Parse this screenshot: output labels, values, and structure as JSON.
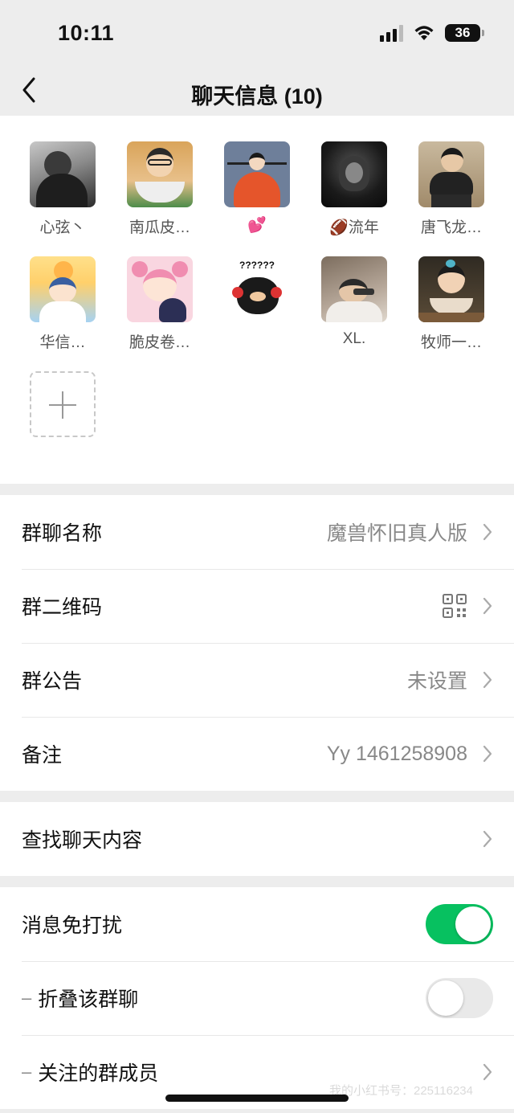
{
  "status_bar": {
    "time": "10:11",
    "battery": "36"
  },
  "nav": {
    "title": "聊天信息 (10)"
  },
  "members": [
    {
      "name": "心弦丶",
      "avatar_colors": [
        "#9a9a9a",
        "#2b2b2b"
      ]
    },
    {
      "name": "南瓜皮…",
      "avatar_colors": [
        "#e8b46a",
        "#3d7a3b"
      ]
    },
    {
      "name": "💕",
      "avatar_colors": [
        "#6a7d9a",
        "#e2552e"
      ]
    },
    {
      "name": "🏈流年",
      "avatar_colors": [
        "#2a2a2a",
        "#0e0e0e"
      ]
    },
    {
      "name": "唐飞龙…",
      "avatar_colors": [
        "#b8a58a",
        "#2b2b2b"
      ]
    },
    {
      "name": "华信…",
      "avatar_colors": [
        "#ffd36b",
        "#7fb7e8"
      ]
    },
    {
      "name": "脆皮卷…",
      "avatar_colors": [
        "#f7c4d6",
        "#2e3154"
      ]
    },
    {
      "name": "",
      "avatar_colors": [
        "#ffffff",
        "#1a1a1a"
      ],
      "sticker_text": "??????"
    },
    {
      "name": "XL.",
      "avatar_colors": [
        "#8c7e70",
        "#d8cfc4"
      ]
    },
    {
      "name": "牧师一…",
      "avatar_colors": [
        "#4b4030",
        "#c9a87a"
      ]
    }
  ],
  "settings_group_1": [
    {
      "label": "群聊名称",
      "value": "魔兽怀旧真人版"
    },
    {
      "label": "群二维码",
      "value": "",
      "icon": "qr-code-icon"
    },
    {
      "label": "群公告",
      "value": "未设置"
    },
    {
      "label": "备注",
      "value": "Yy 1461258908"
    }
  ],
  "settings_group_2": [
    {
      "label": "查找聊天内容"
    }
  ],
  "settings_group_3": [
    {
      "label": "消息免打扰",
      "toggle": true
    },
    {
      "label": "折叠该群聊",
      "toggle": false,
      "dash": "–"
    },
    {
      "label": "关注的群成员",
      "dash": "–"
    }
  ],
  "watermark": "我的小红书号：225116234",
  "colors": {
    "accent": "#07c160",
    "background": "#ededed"
  }
}
